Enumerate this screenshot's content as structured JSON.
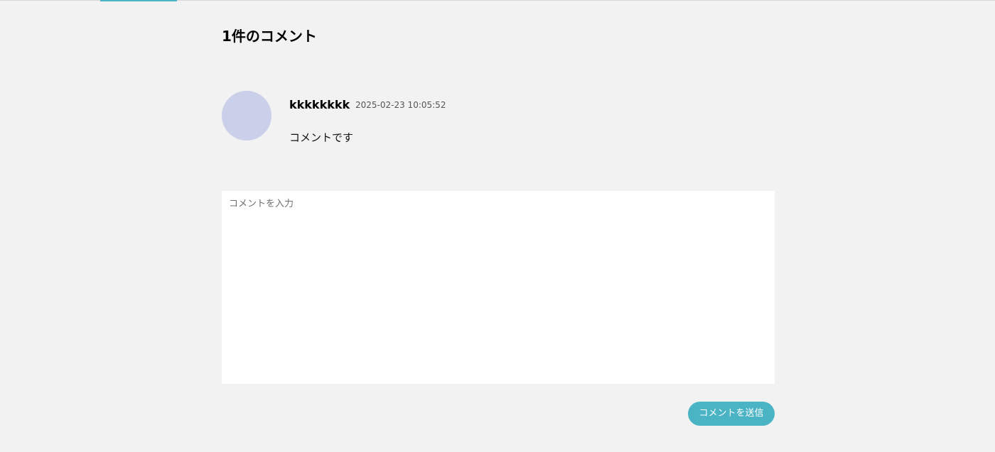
{
  "theme": {
    "accent_color": "#4ab3c4",
    "avatar_color": "#cacfea",
    "background_color": "#f2f2f2"
  },
  "comments_section": {
    "title": "1件のコメント",
    "comments": [
      {
        "author": "kkkkkkkk",
        "timestamp": "2025-02-23 10:05:52",
        "body": "コメントです"
      }
    ]
  },
  "comment_form": {
    "placeholder": "コメントを入力",
    "value": "",
    "submit_label": "コメントを送信"
  }
}
